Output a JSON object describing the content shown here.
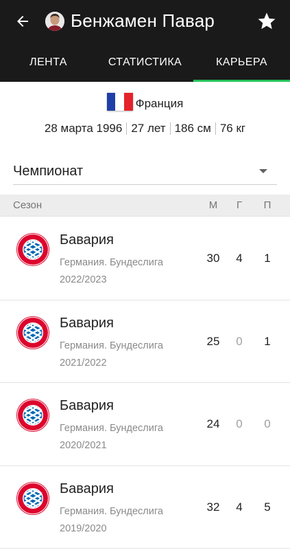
{
  "header": {
    "player_name": "Бенжамен Павар",
    "icons": {
      "back": "arrow-left-icon",
      "favorite": "star-icon"
    }
  },
  "tabs": [
    {
      "label": "ЛЕНТА",
      "active": false
    },
    {
      "label": "СТАТИСТИКА",
      "active": false
    },
    {
      "label": "КАРЬЕРА",
      "active": true
    }
  ],
  "profile": {
    "country": "Франция",
    "birth_date": "28 марта 1996",
    "age": "27 лет",
    "height": "186 см",
    "weight": "76 кг"
  },
  "filter": {
    "selected": "Чемпионат"
  },
  "table": {
    "headers": {
      "season": "Сезон",
      "matches": "М",
      "goals": "Г",
      "assists": "П"
    },
    "rows": [
      {
        "club": "Бавария",
        "league": "Германия. Бундеслига",
        "season": "2022/2023",
        "matches": "30",
        "goals": "4",
        "assists": "1"
      },
      {
        "club": "Бавария",
        "league": "Германия. Бундеслига",
        "season": "2021/2022",
        "matches": "25",
        "goals": "0",
        "assists": "1"
      },
      {
        "club": "Бавария",
        "league": "Германия. Бундеслига",
        "season": "2020/2021",
        "matches": "24",
        "goals": "0",
        "assists": "0"
      },
      {
        "club": "Бавария",
        "league": "Германия. Бундеслига",
        "season": "2019/2020",
        "matches": "32",
        "goals": "4",
        "assists": "5"
      }
    ]
  },
  "colors": {
    "app_bar": "#1a1a1a",
    "tab_indicator": "#26c25a",
    "flag_blue": "#1f3fa8",
    "flag_white": "#ffffff",
    "flag_red": "#e4232b",
    "bayern_red": "#dc052d",
    "bayern_blue": "#0066b2"
  }
}
